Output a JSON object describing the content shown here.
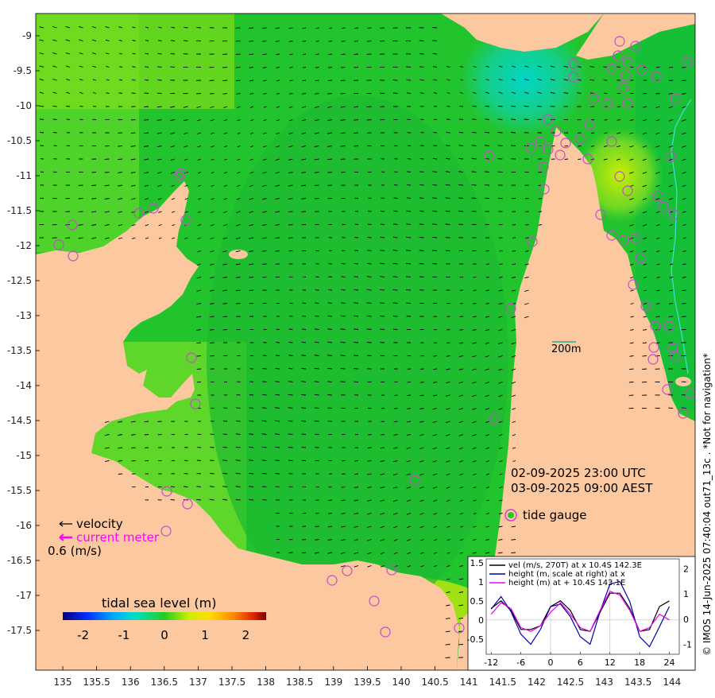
{
  "map": {
    "x_ticks": [
      "135",
      "135.5",
      "136",
      "136.5",
      "137",
      "137.5",
      "138",
      "138.5",
      "139",
      "139.5",
      "140",
      "140.5",
      "141",
      "141.5",
      "142",
      "142.5",
      "143",
      "143.5",
      "144"
    ],
    "y_ticks": [
      "-9",
      "-9.5",
      "-10",
      "-10.5",
      "-11",
      "-11.5",
      "-12",
      "-12.5",
      "-13",
      "-13.5",
      "-14",
      "-14.5",
      "-15",
      "-15.5",
      "-16",
      "-16.5",
      "-17",
      "-17.5"
    ],
    "colors": {
      "land": "#fbc8a0",
      "sea_level_zero": "#22cc22",
      "arrow": "#000000",
      "gauge_ring": "#cc44cc"
    }
  },
  "timestamp": {
    "utc": "02-09-2025 23:00 UTC",
    "local": "03-09-2025 09:00 AEST"
  },
  "scale_bar": {
    "label": "200m"
  },
  "legend": {
    "velocity_label": "velocity",
    "current_meter_label": "current meter",
    "speed_ref": "0.6 (m/s)",
    "tide_gauge_label": "tide gauge"
  },
  "colorbar": {
    "title": "tidal sea level (m)",
    "ticks": [
      "-2",
      "-1",
      "0",
      "1",
      "2"
    ],
    "range": [
      -2.5,
      2.5
    ]
  },
  "credit": "© IMOS 14-Jun-2025 07:40:04 out71_13c . *Not for navigation*",
  "timeseries": {
    "legend": [
      {
        "label": "vel (m/s, 270T) at x 10.4S 142.3E",
        "color": "#000000"
      },
      {
        "label": "height (m, scale at right) at x",
        "color": "#0000aa"
      },
      {
        "label": "height (m) at + 10.4S 143.1E",
        "color": "#ee00ee"
      }
    ],
    "x_ticks": [
      "-12",
      "-6",
      "0",
      "6",
      "12",
      "18",
      "24"
    ],
    "y_left_ticks": [
      "1.5",
      "1",
      "0.5",
      "0",
      "-0.5"
    ],
    "y_right_ticks": [
      "2",
      "1",
      "0",
      "-1"
    ]
  },
  "chart_data": {
    "type": "line",
    "title": "",
    "xlabel": "",
    "ylabel": "",
    "xlim": [
      -13,
      26
    ],
    "ylim": [
      -0.9,
      1.6
    ],
    "y2lim": [
      -1.4,
      2.4
    ],
    "x": [
      -12,
      -10,
      -8,
      -6,
      -4,
      -2,
      0,
      2,
      4,
      6,
      8,
      10,
      12,
      14,
      16,
      18,
      20,
      22,
      24
    ],
    "series": [
      {
        "name": "vel (m/s, 270T) at x 10.4S 142.3E",
        "axis": "left",
        "values": [
          0.3,
          0.5,
          0.25,
          -0.25,
          -0.25,
          -0.15,
          0.35,
          0.5,
          0.25,
          -0.25,
          -0.3,
          0.2,
          0.7,
          0.7,
          0.3,
          -0.3,
          -0.25,
          0.35,
          0.5
        ]
      },
      {
        "name": "height (m, scale at right) at x",
        "axis": "right",
        "values": [
          0.4,
          0.9,
          0.3,
          -0.6,
          -1.0,
          -0.4,
          0.5,
          0.6,
          0.1,
          -0.7,
          -1.0,
          0.3,
          1.4,
          1.5,
          0.7,
          -0.7,
          -1.1,
          -0.3,
          0.5
        ]
      },
      {
        "name": "height (m) at + 10.4S 143.1E",
        "axis": "left",
        "values": [
          0.15,
          0.45,
          0.3,
          -0.2,
          -0.3,
          -0.15,
          0.2,
          0.45,
          0.15,
          -0.2,
          -0.3,
          0.25,
          0.75,
          0.65,
          0.25,
          -0.3,
          -0.2,
          0.15,
          0.0
        ]
      }
    ]
  }
}
